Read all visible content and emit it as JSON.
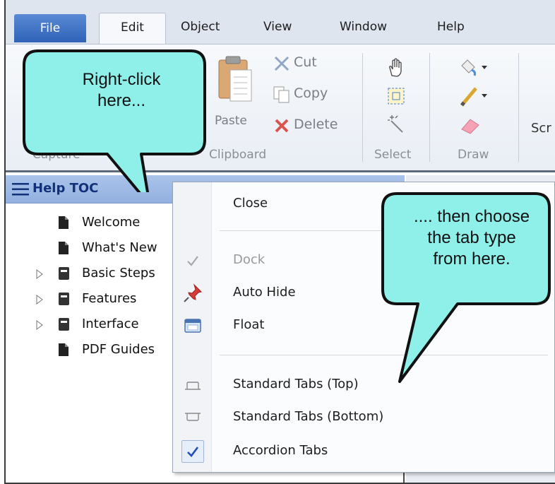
{
  "menubar": {
    "tabs": [
      "File",
      "Edit",
      "Object",
      "View",
      "Window",
      "Help"
    ]
  },
  "ribbon": {
    "clipboard": {
      "paste": "Paste",
      "cut": "Cut",
      "copy": "Copy",
      "delete": "Delete"
    },
    "partial_label": "Scr",
    "groups": [
      "Capture",
      "Clipboard",
      "Select",
      "Draw"
    ]
  },
  "pane": {
    "title": "Help TOC",
    "items": [
      {
        "label": "Welcome",
        "type": "page",
        "expandable": false
      },
      {
        "label": "What's New",
        "type": "page",
        "expandable": false
      },
      {
        "label": "Basic Steps",
        "type": "book",
        "expandable": true
      },
      {
        "label": "Features",
        "type": "book",
        "expandable": true
      },
      {
        "label": "Interface",
        "type": "book",
        "expandable": true
      },
      {
        "label": "PDF Guides",
        "type": "page",
        "expandable": false
      }
    ]
  },
  "context_menu": {
    "close": "Close",
    "dock": "Dock",
    "auto_hide": "Auto Hide",
    "float": "Float",
    "standard_top": "Standard Tabs (Top)",
    "standard_bottom": "Standard Tabs (Bottom)",
    "accordion": "Accordion Tabs"
  },
  "callouts": {
    "left": [
      "Right-click",
      "here..."
    ],
    "right": [
      ".... then choose",
      "the tab type",
      "from here."
    ]
  },
  "colors": {
    "callout_fill": "#8ff0ea",
    "accent_blue": "#2f63b8",
    "check_blue": "#1f4fbf"
  }
}
